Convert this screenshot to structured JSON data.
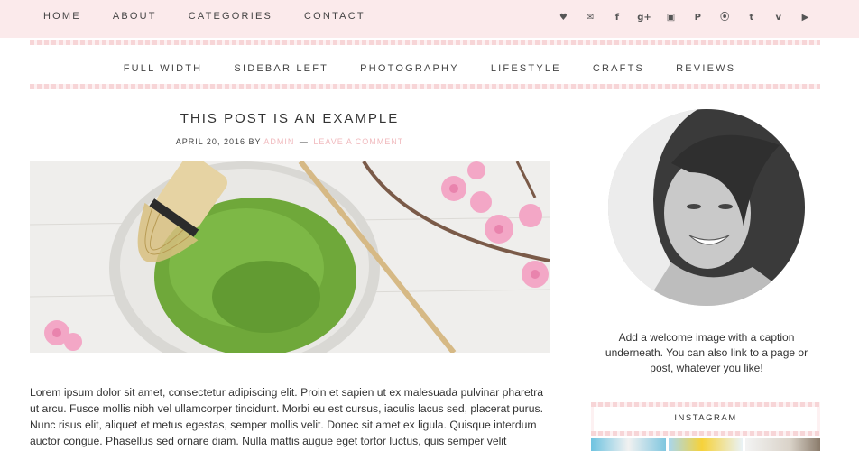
{
  "topnav": [
    "HOME",
    "ABOUT",
    "CATEGORIES",
    "CONTACT"
  ],
  "social_icons": [
    {
      "name": "heart-icon",
      "glyph": "♥"
    },
    {
      "name": "email-icon",
      "glyph": "✉"
    },
    {
      "name": "facebook-icon",
      "glyph": "f"
    },
    {
      "name": "google-plus-icon",
      "glyph": "g+"
    },
    {
      "name": "instagram-icon",
      "glyph": "▣"
    },
    {
      "name": "pinterest-icon",
      "glyph": "P"
    },
    {
      "name": "rss-icon",
      "glyph": "⦿"
    },
    {
      "name": "twitter-icon",
      "glyph": "t"
    },
    {
      "name": "vimeo-icon",
      "glyph": "v"
    },
    {
      "name": "youtube-icon",
      "glyph": "▶"
    }
  ],
  "catnav": [
    "FULL WIDTH",
    "SIDEBAR LEFT",
    "PHOTOGRAPHY",
    "LIFESTYLE",
    "CRAFTS",
    "REVIEWS"
  ],
  "post": {
    "title": "THIS POST IS AN EXAMPLE",
    "date": "APRIL 20, 2016",
    "by": "BY",
    "author": "ADMIN",
    "separator": "—",
    "comment_link": "LEAVE A COMMENT",
    "body": "Lorem ipsum dolor sit amet, consectetur adipiscing elit. Proin et sapien ut ex malesuada pulvinar pharetra ut arcu. Fusce mollis nibh vel ullamcorper tincidunt. Morbi eu est cursus, iaculis lacus sed, placerat purus. Nunc risus elit, aliquet et metus egestas, semper mollis velit. Donec sit amet ex ligula. Quisque interdum auctor congue. Phasellus sed ornare diam. Nulla mattis augue eget tortor luctus, quis semper velit"
  },
  "sidebar": {
    "caption": "Add a welcome image with a caption underneath. You can also link to a page or post, whatever you like!",
    "instagram_title": "INSTAGRAM"
  },
  "colors": {
    "topbar_bg": "#fbeaeb",
    "accent_pink": "#f0b9bd",
    "matcha_green": "#6fa83a"
  }
}
